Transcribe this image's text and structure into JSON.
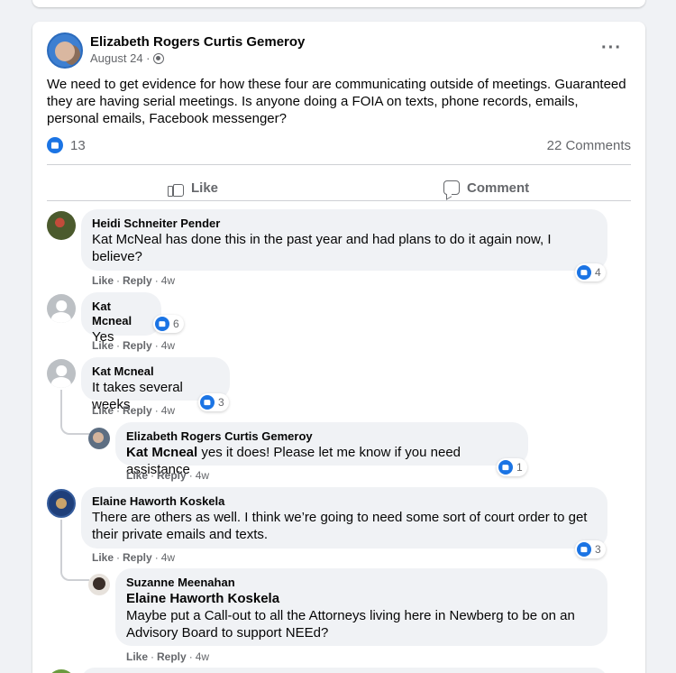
{
  "post": {
    "author": "Elizabeth Rogers Curtis Gemeroy",
    "date": "August 24 ·",
    "text": "We need to get evidence for how these four are communicating outside of meetings. Guaranteed they are having serial meetings. Is anyone doing a FOIA on texts, phone records, emails, personal emails, Facebook messenger?",
    "reaction_count": "13",
    "comments_count": "22 Comments",
    "more_label": "···"
  },
  "actions": {
    "like": "Like",
    "comment": "Comment"
  },
  "comment_actions": {
    "like": "Like",
    "reply": "Reply",
    "sep": "·"
  },
  "comments": [
    {
      "name": "Heidi Schneiter Pender",
      "text": "Kat McNeal has done this in the past year and had plans to do it again now, I believe?",
      "reactions": "4",
      "age": "4w"
    },
    {
      "name": "Kat Mcneal",
      "text": "Yes",
      "reactions": "6",
      "age": "4w"
    },
    {
      "name": "Kat Mcneal",
      "text": "It takes several weeks",
      "reactions": "3",
      "age": "4w"
    },
    {
      "name": "Elizabeth Rogers Curtis Gemeroy",
      "tag": "Kat Mcneal",
      "text": " yes it does! Please let me know if you need assistance",
      "reactions": "1",
      "age": "4w"
    },
    {
      "name": "Elaine Haworth Koskela",
      "text": "There are others as well. I think we’re going to need some sort of court order to get their private emails and texts.",
      "reactions": "3",
      "age": "4w"
    },
    {
      "name": "Suzanne Meenahan",
      "tag": "Elaine Haworth Koskela",
      "text": "Maybe put a Call-out to all the Attorneys living here in Newberg to be on an Advisory Board to support NEEd?",
      "age": "4w"
    }
  ],
  "colors": {
    "accent": "#1b74e4",
    "muted": "#65676b",
    "bubble": "#f0f2f5"
  }
}
